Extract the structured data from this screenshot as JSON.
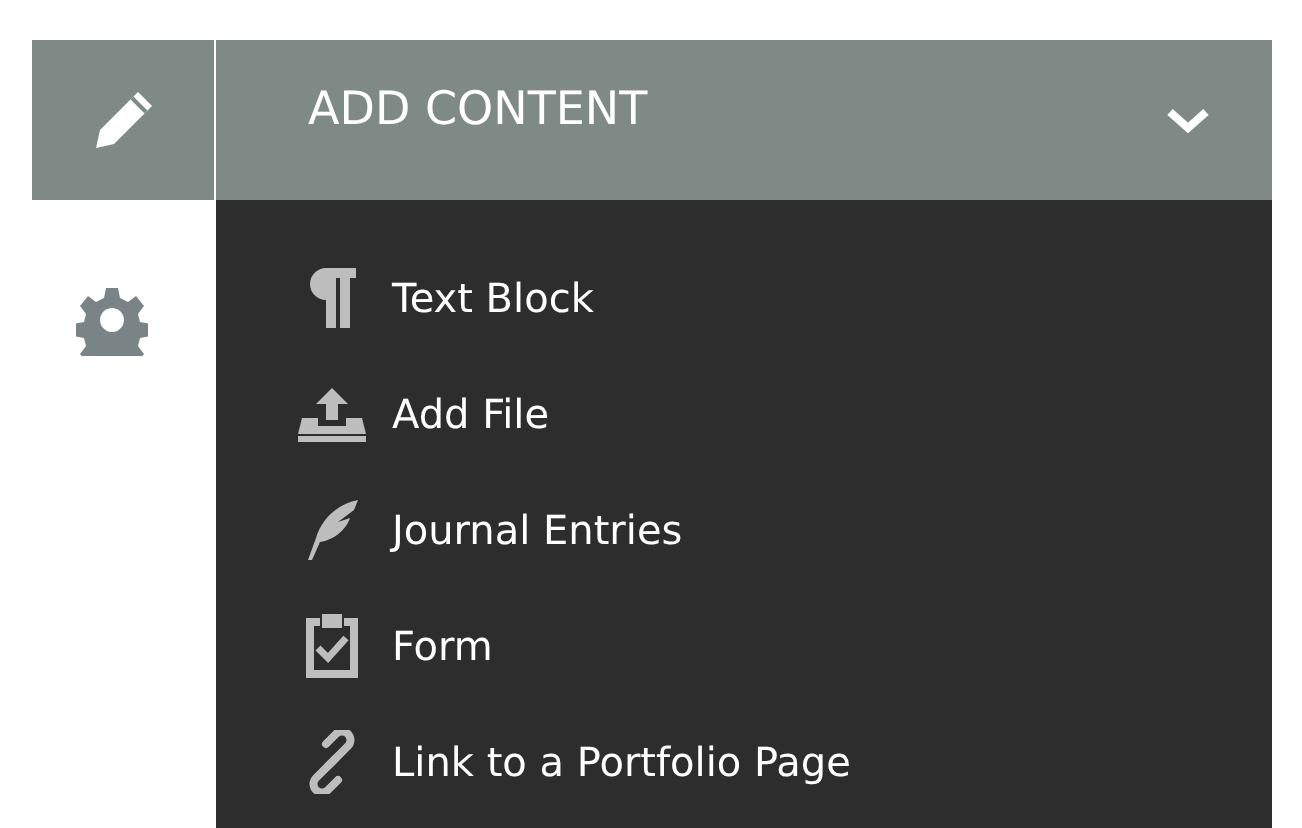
{
  "panel": {
    "title": "ADD CONTENT",
    "expanded": true
  },
  "items": [
    {
      "kind": "text",
      "label": "Text Block"
    },
    {
      "kind": "file",
      "label": "Add File"
    },
    {
      "kind": "journal",
      "label": "Journal Entries"
    },
    {
      "kind": "form",
      "label": "Form"
    },
    {
      "kind": "link",
      "label": "Link to a Portfolio Page"
    }
  ]
}
